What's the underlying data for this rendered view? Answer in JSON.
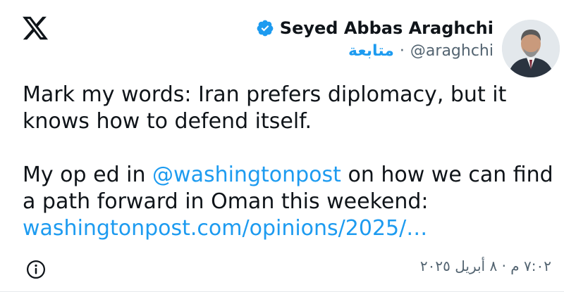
{
  "header": {
    "display_name": "Seyed Abbas Araghchi",
    "handle": "@araghchi",
    "separator": "·",
    "follow_label": "متابعة"
  },
  "tweet": {
    "line1": "Mark my words: Iran prefers diplomacy, but it knows how to defend itself.",
    "p2_before": "My op ed in ",
    "mention": "@washingtonpost",
    "p2_after": " on how we can find a path forward in Oman this weekend:",
    "link": "washingtonpost.com/opinions/2025/…"
  },
  "footer": {
    "timestamp": "٧:٠٢ م · ٨ أبريل ٢٠٢٥"
  },
  "icons": {
    "logo": "x-logo-icon",
    "verified": "verified-badge-icon",
    "info": "info-icon"
  },
  "colors": {
    "accent": "#1d9bf0",
    "text": "#0f1419",
    "muted": "#536471"
  }
}
